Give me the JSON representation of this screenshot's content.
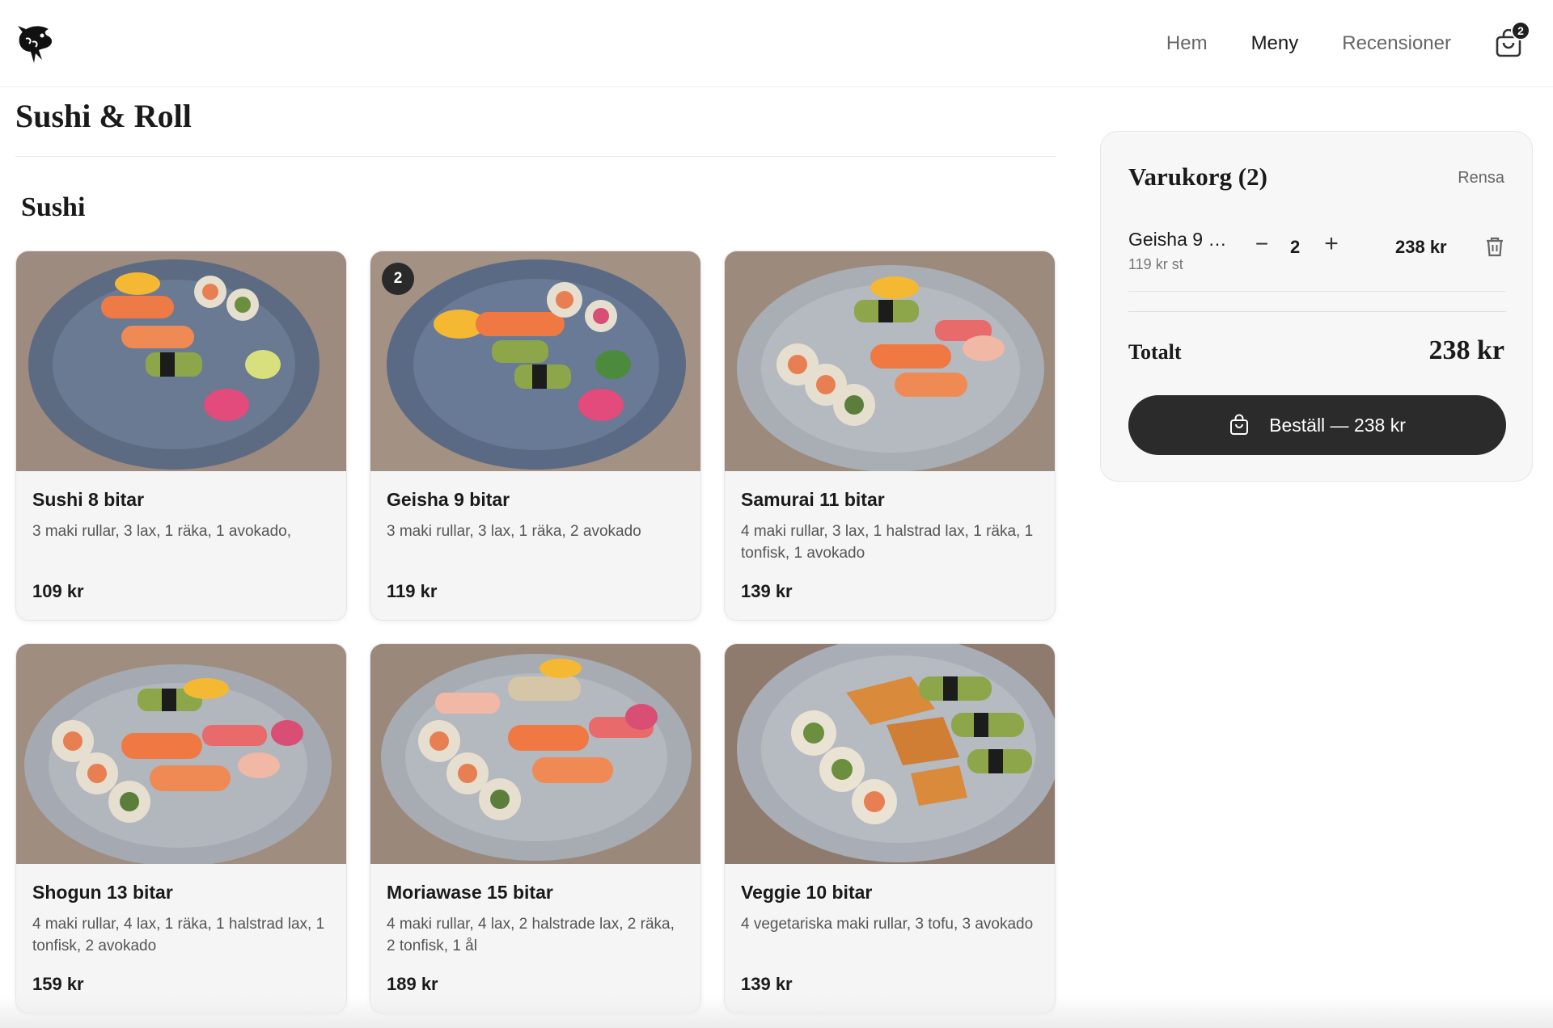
{
  "nav": {
    "items": [
      {
        "label": "Hem",
        "active": false
      },
      {
        "label": "Meny",
        "active": true
      },
      {
        "label": "Recensioner",
        "active": false
      }
    ],
    "cart_count": "2",
    "logo_icon": "fish-logo-icon",
    "cart_icon": "shopping-bag-icon"
  },
  "page": {
    "title": "Sushi & Roll",
    "section": "Sushi"
  },
  "products": [
    {
      "name": "Sushi 8 bitar",
      "desc": "3 maki rullar, 3 lax, 1 räka, 1 avokado,",
      "price": "109 kr",
      "in_cart": ""
    },
    {
      "name": "Geisha 9 bitar",
      "desc": "3 maki rullar, 3 lax, 1 räka, 2 avokado",
      "price": "119 kr",
      "in_cart": "2"
    },
    {
      "name": "Samurai 11 bitar",
      "desc": "4 maki rullar, 3 lax, 1 halstrad lax, 1 räka, 1 tonfisk, 1 avokado",
      "price": "139 kr",
      "in_cart": ""
    },
    {
      "name": "Shogun 13 bitar",
      "desc": "4 maki rullar, 4 lax, 1 räka, 1 halstrad lax, 1 tonfisk, 2 avokado",
      "price": "159 kr",
      "in_cart": ""
    },
    {
      "name": "Moriawase 15 bitar",
      "desc": "4 maki rullar, 4 lax, 2 halstrade lax, 2 räka, 2 tonfisk, 1 ål",
      "price": "189 kr",
      "in_cart": ""
    },
    {
      "name": "Veggie 10 bitar",
      "desc": "4 vegetariska maki rullar, 3 tofu, 3 avokado",
      "price": "139 kr",
      "in_cart": ""
    }
  ],
  "cart": {
    "title": "Varukorg (2)",
    "clear_label": "Rensa",
    "items": [
      {
        "name": "Geisha 9 …",
        "unit_price": "119 kr st",
        "qty": "2",
        "minus": "−",
        "plus": "+",
        "line_total": "238 kr"
      }
    ],
    "total_label": "Totalt",
    "total_value": "238 kr",
    "order_label": "Beställ — 238 kr"
  },
  "colors": {
    "accent_dark": "#2b2b2b",
    "panel_bg": "#f7f7f7",
    "card_bg": "#f5f5f5"
  }
}
